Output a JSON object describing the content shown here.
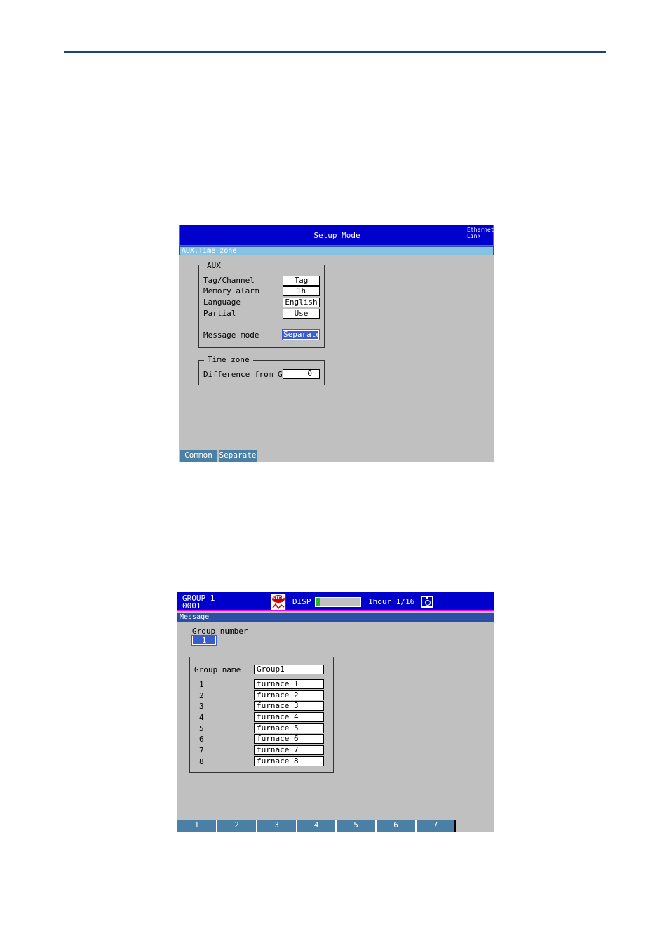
{
  "setup_screen": {
    "title": "Setup Mode",
    "corner_line1": "Ethernet",
    "corner_line2": "Link",
    "subheader": "AUX,Time zone",
    "aux": {
      "legend": "AUX",
      "rows": [
        {
          "label": "Tag/Channel",
          "value": "Tag"
        },
        {
          "label": "Memory alarm",
          "value": "1h"
        },
        {
          "label": "Language",
          "value": "English"
        },
        {
          "label": "Partial",
          "value": "Use"
        }
      ],
      "message_mode_label": "Message mode",
      "message_mode_value": "Separate"
    },
    "timezone": {
      "legend": "Time zone",
      "label": "Difference from GMT",
      "value": "0"
    },
    "softkeys": [
      "Common",
      "Separate"
    ]
  },
  "message_screen": {
    "group_title": "GROUP 1",
    "group_code": "0001",
    "status_icon_text": "STOP",
    "disp_label": "DISP",
    "time_label": "1hour 1/16",
    "subheader": "Message",
    "group_number_label": "Group number",
    "group_number_value": "1",
    "group_name_label": "Group name",
    "group_name_value": "Group1",
    "messages": [
      {
        "num": "1",
        "text": "furnace 1"
      },
      {
        "num": "2",
        "text": "furnace 2"
      },
      {
        "num": "3",
        "text": "furnace 3"
      },
      {
        "num": "4",
        "text": "furnace 4"
      },
      {
        "num": "5",
        "text": "furnace 5"
      },
      {
        "num": "6",
        "text": "furnace 6"
      },
      {
        "num": "7",
        "text": "furnace 7"
      },
      {
        "num": "8",
        "text": "furnace 8"
      }
    ],
    "softkeys": [
      "1",
      "2",
      "3",
      "4",
      "5",
      "6",
      "7"
    ]
  },
  "colors": {
    "header_blue": "#0000cd",
    "header_border": "#ff00ff",
    "screen_gray": "#c0c0c0",
    "selected_blue": "#3a5ccc",
    "softkey_blue": "#4a7fa6",
    "setup_subheader": "#87c3e0",
    "message_subheader": "#2b4fa6",
    "page_rule": "#1f3d8f"
  }
}
